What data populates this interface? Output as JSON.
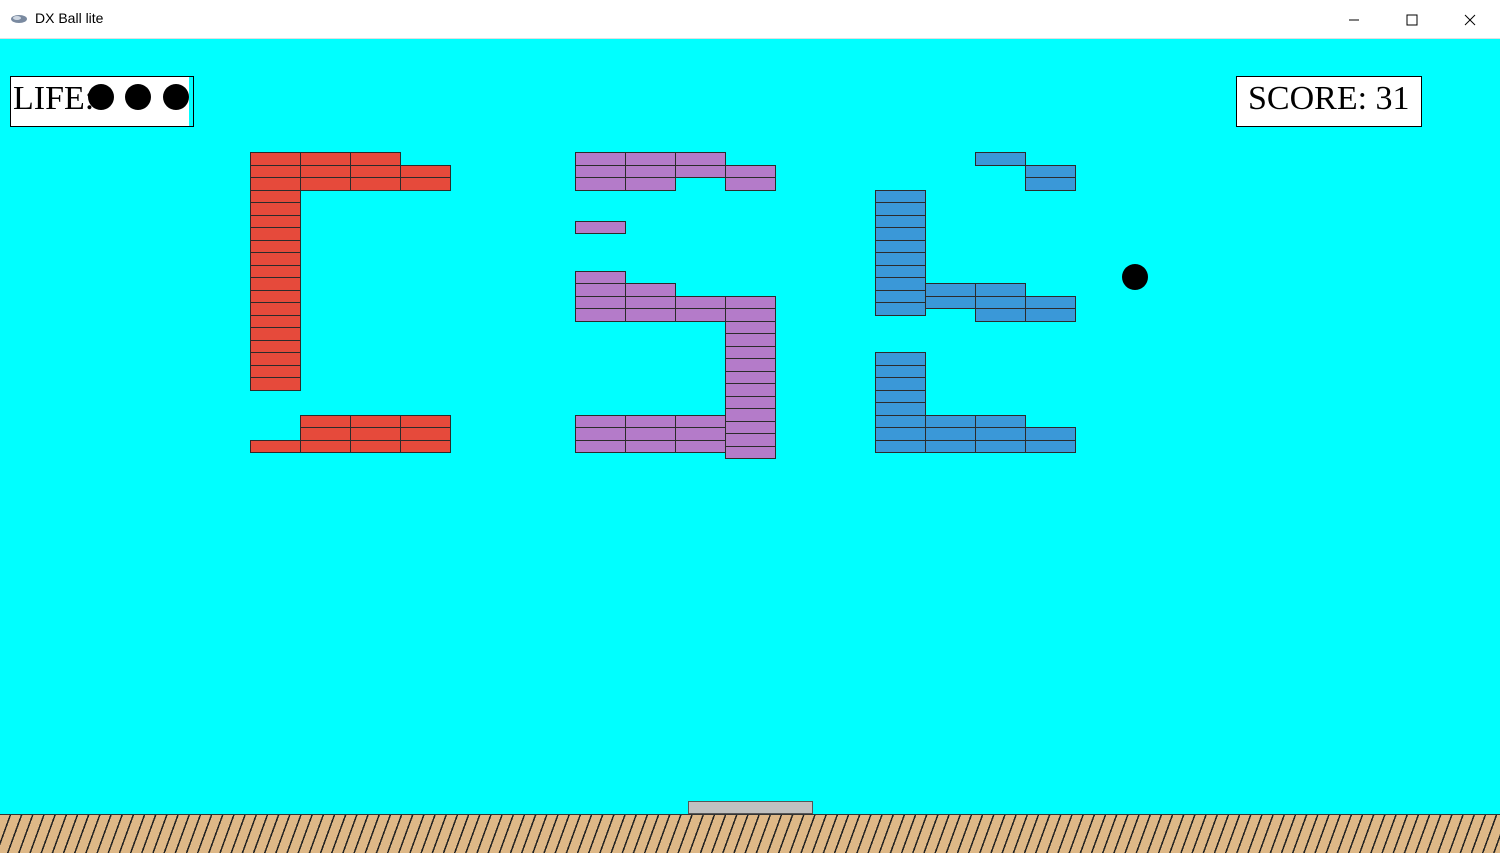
{
  "window": {
    "title": "DX Ball lite",
    "app_icon": "dx-ball-app-icon",
    "controls": [
      "minimize-icon",
      "maximize-icon",
      "close-icon"
    ]
  },
  "hud": {
    "life_label": "LIFE:",
    "lives": 3,
    "score_text": "SCORE: 31"
  },
  "colors": {
    "background": "#00ffff",
    "brick_red": "#e64a3b",
    "brick_purple": "#b47bc9",
    "brick_blue": "#3a98d8",
    "ball": "#000000",
    "paddle": "#c0c0c0",
    "ground": "#deb887"
  },
  "bricks": {
    "remaining": 137
  }
}
